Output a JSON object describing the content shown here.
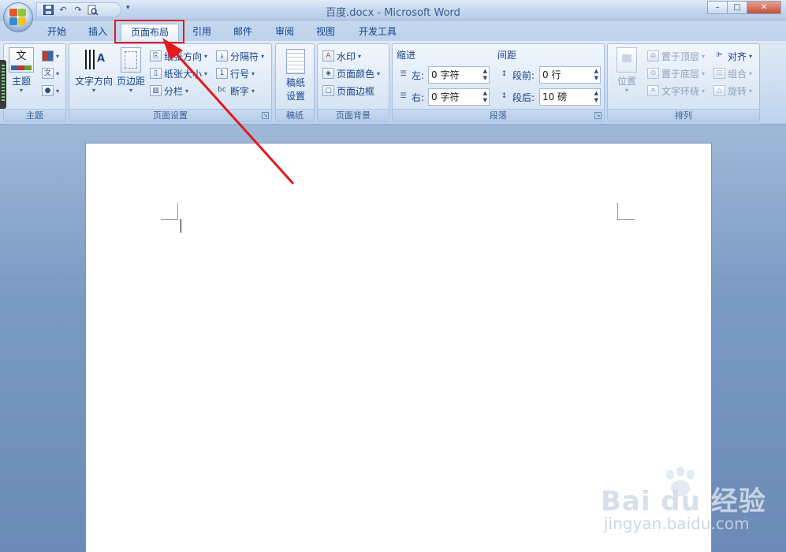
{
  "window": {
    "title": "百度.docx - Microsoft Word",
    "minimize": "–",
    "restore": "□",
    "close": "✕"
  },
  "quick_access": {
    "save_icon": "save-icon",
    "undo_icon": "undo-icon",
    "redo_icon": "redo-icon",
    "print_preview_icon": "print-preview-icon",
    "dropdown": "▾"
  },
  "tabs": [
    {
      "label": "开始"
    },
    {
      "label": "插入"
    },
    {
      "label": "页面布局"
    },
    {
      "label": "引用"
    },
    {
      "label": "邮件"
    },
    {
      "label": "审阅"
    },
    {
      "label": "视图"
    },
    {
      "label": "开发工具"
    }
  ],
  "ribbon": {
    "theme": {
      "label": "主题",
      "theme_button": "主题",
      "theme_icon_text": "文"
    },
    "page_setup": {
      "label": "页面设置",
      "text_direction": "文字方向",
      "margins": "页边距",
      "orientation": "纸张方向",
      "size": "纸张大小",
      "columns": "分栏",
      "breaks": "分隔符",
      "line_numbers": "行号",
      "hyphenation": "断字"
    },
    "draft_paper": {
      "label": "稿纸",
      "setup_line1": "稿纸",
      "setup_line2": "设置"
    },
    "page_background": {
      "label": "页面背景",
      "watermark": "水印",
      "page_color": "页面颜色",
      "page_borders": "页面边框"
    },
    "paragraph": {
      "label": "段落",
      "indent_header": "缩进",
      "spacing_header": "间距",
      "left_label": "左:",
      "left_value": "0 字符",
      "right_label": "右:",
      "right_value": "0 字符",
      "before_label": "段前:",
      "before_value": "0 行",
      "after_label": "段后:",
      "after_value": "10 磅"
    },
    "arrange": {
      "label": "排列",
      "position": "位置",
      "bring_front": "置于顶层",
      "send_back": "置于底层",
      "text_wrap": "文字环绕",
      "align": "对齐",
      "group": "组合",
      "rotate": "旋转"
    }
  },
  "watermark": {
    "brand": "Bai du 经验",
    "url": "jingyan.baidu.com"
  },
  "colors": {
    "highlight": "#e2191e",
    "ribbon_text": "#15428b"
  }
}
